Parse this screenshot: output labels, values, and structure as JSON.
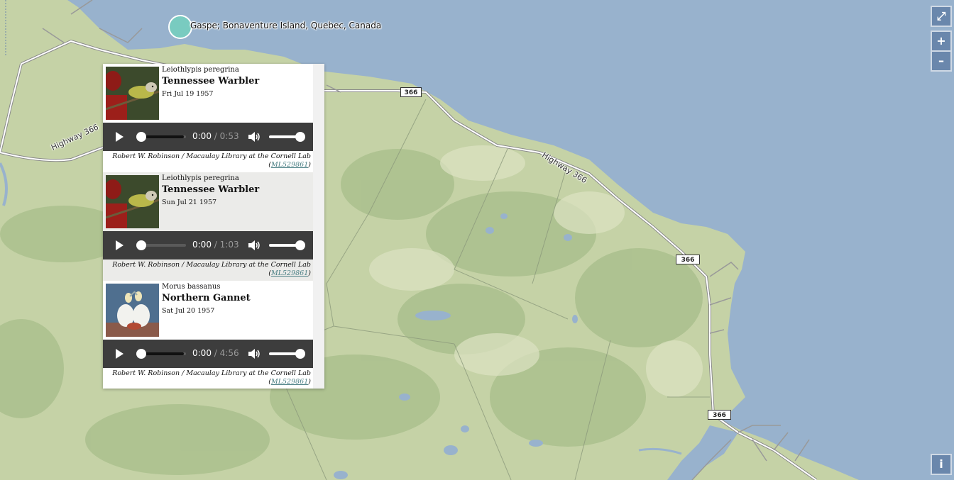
{
  "map": {
    "place_label": "Gaspe; Bonaventure Island, Quebec, Canada",
    "roads": {
      "highway_a": "Highway 366",
      "highway_b": "Highway 366",
      "shield_1": "366",
      "shield_2": "366",
      "shield_3": "366"
    },
    "colors": {
      "water": "#98b2cd",
      "land": "#c6d3a8",
      "marker": "#79cbc0"
    }
  },
  "controls": {
    "fullscreen_icon": "expand-icon",
    "fullscreen_glyph": "⤢",
    "zoom_in": "+",
    "zoom_out": "–",
    "info": "i"
  },
  "popup": {
    "observations": [
      {
        "scientific_name": "Leiothlypis peregrina",
        "common_name": "Tennessee Warbler",
        "date": "Fri Jul 19 1957",
        "time": "0:00",
        "duration": "/ 0:53",
        "buffered": 0.95,
        "credit": "Robert W. Robinson / Macaulay Library at the Cornell Lab",
        "catalog_id": "ML529861"
      },
      {
        "scientific_name": "Leiothlypis peregrina",
        "common_name": "Tennessee Warbler",
        "date": "Sun Jul 21 1957",
        "time": "0:00",
        "duration": "/ 1:03",
        "buffered": 0.0,
        "credit": "Robert W. Robinson / Macaulay Library at the Cornell Lab",
        "catalog_id": "ML529861"
      },
      {
        "scientific_name": "Morus bassanus",
        "common_name": "Northern Gannet",
        "date": "Sat Jul 20 1957",
        "time": "0:00",
        "duration": "/ 4:56",
        "buffered": 0.95,
        "credit": "Robert W. Robinson / Macaulay Library at the Cornell Lab",
        "catalog_id": "ML529861"
      }
    ]
  }
}
